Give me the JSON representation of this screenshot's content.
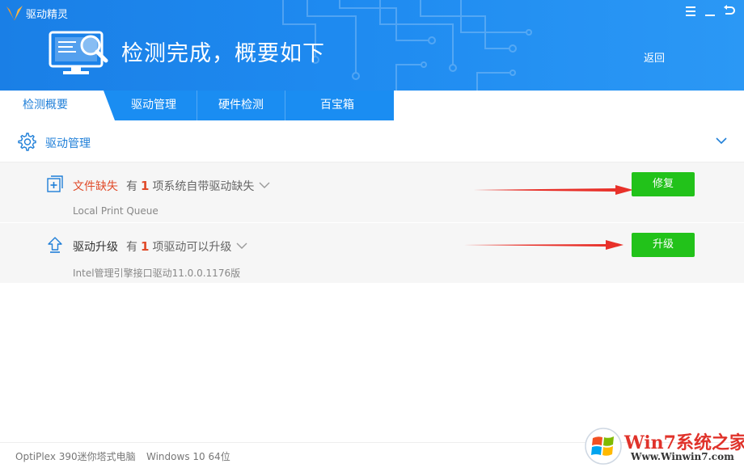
{
  "app": {
    "title": "驱动精灵"
  },
  "header": {
    "headline": "检测完成，概要如下",
    "back_label": "返回"
  },
  "tabs": [
    {
      "label": "检测概要",
      "active": true
    },
    {
      "label": "驱动管理",
      "active": false
    },
    {
      "label": "硬件检测",
      "active": false
    },
    {
      "label": "百宝箱",
      "active": false
    }
  ],
  "section": {
    "title": "驱动管理"
  },
  "rows": [
    {
      "title": "文件缺失",
      "prefix": "有",
      "count": "1",
      "suffix": "项系统自带驱动缺失",
      "detail": "Local Print Queue",
      "button": "修复"
    },
    {
      "title": "驱动升级",
      "prefix": "有",
      "count": "1",
      "suffix": "项驱动可以升级",
      "detail": "Intel管理引擎接口驱动11.0.0.1176版",
      "button": "升级"
    }
  ],
  "footer": {
    "model": "OptiPlex 390迷你塔式电脑",
    "os": "Windows 10 64位"
  },
  "watermark": {
    "brand": "Win7系统之家",
    "url": "Www.Winwin7.com"
  },
  "colors": {
    "header_blue": "#1e8af0",
    "accent_blue": "#1f7fd8",
    "alert_red": "#e04b2a",
    "action_green": "#22c21a"
  },
  "icons": {
    "logo": "driver-genius-logo-icon",
    "menu": "menu-icon",
    "minimize": "minimize-icon",
    "back_window": "back-arrow-icon",
    "monitor": "monitor-search-icon",
    "gear": "gear-icon",
    "collapse": "chevron-down-icon",
    "missing": "missing-file-icon",
    "upgrade": "upgrade-arrow-icon"
  }
}
